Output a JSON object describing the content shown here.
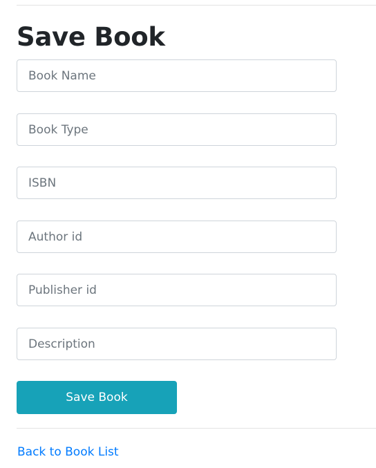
{
  "page": {
    "title": "Save Book"
  },
  "form": {
    "fields": [
      {
        "placeholder": "Book Name",
        "value": ""
      },
      {
        "placeholder": "Book Type",
        "value": ""
      },
      {
        "placeholder": "ISBN",
        "value": ""
      },
      {
        "placeholder": "Author id",
        "value": ""
      },
      {
        "placeholder": "Publisher id",
        "value": ""
      },
      {
        "placeholder": "Description",
        "value": ""
      }
    ],
    "submit_label": "Save Book"
  },
  "back_link": {
    "label": "Back to Book List"
  },
  "colors": {
    "button": "#17a2b8",
    "link": "#007bff"
  }
}
